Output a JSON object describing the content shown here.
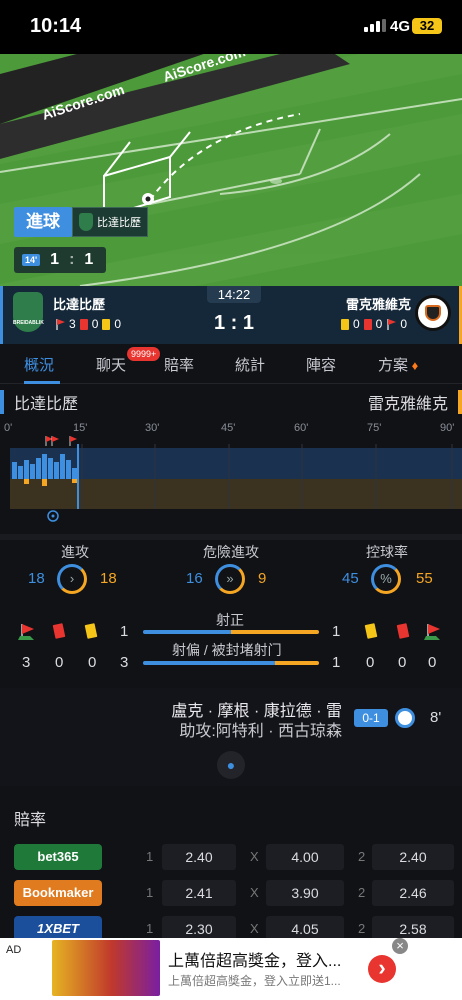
{
  "status": {
    "time": "10:14",
    "network": "4G",
    "battery": "32"
  },
  "pitch": {
    "watermark": "AiScore.com",
    "goal_label": "進球",
    "goal_team": "比達比歷",
    "minute": "14'",
    "score_home": "1",
    "score_away": "1"
  },
  "match": {
    "time": "14:22",
    "score": "1 : 1",
    "home": {
      "name": "比達比歷",
      "corners": "3",
      "red": "0",
      "yellow": "0",
      "crest_text": "BREIDABLIK"
    },
    "away": {
      "name": "雷克雅維克",
      "corners": "0",
      "red": "0",
      "yellow": "0"
    }
  },
  "tabs": [
    {
      "label": "概況"
    },
    {
      "label": "聊天"
    },
    {
      "label": "賠率"
    },
    {
      "label": "統計"
    },
    {
      "label": "陣容"
    },
    {
      "label": "方案"
    }
  ],
  "chat_badge": "9999+",
  "timeline": {
    "home": "比達比歷",
    "away": "雷克雅維克",
    "ticks": [
      "0'",
      "15'",
      "30'",
      "45'",
      "60'",
      "75'",
      "90'"
    ]
  },
  "stats": {
    "attack": {
      "label": "進攻",
      "home": "18",
      "away": "18"
    },
    "danger": {
      "label": "危險進攻",
      "home": "16",
      "away": "9"
    },
    "possession": {
      "label": "控球率",
      "home": "45",
      "away": "55",
      "symbol": "%"
    },
    "on_target": {
      "label": "射正",
      "home": "1",
      "away": "1"
    },
    "off_target": {
      "label": "射偏 / 被封堵射门",
      "home": "3",
      "away": "1"
    },
    "home_row": {
      "corners": "3",
      "red": "0",
      "yellow": "0"
    },
    "away_row": {
      "corners": "0",
      "red": "0",
      "yellow": "0"
    }
  },
  "event": {
    "scorer": "盧克 · 摩根 · 康拉德 · 雷",
    "assist": "助攻:阿特利 · 西古琼森",
    "score": "0-1",
    "minute": "8'"
  },
  "odds": {
    "title": "賠率",
    "rows": [
      {
        "bookmaker": "bet365",
        "color": "#1f7a3a",
        "c1": "1",
        "v1": "2.40",
        "cx": "X",
        "vx": "4.00",
        "c2": "2",
        "v2": "2.40"
      },
      {
        "bookmaker": "Bookmaker",
        "color": "#e07b1f",
        "c1": "1",
        "v1": "2.41",
        "cx": "X",
        "vx": "3.90",
        "c2": "2",
        "v2": "2.46"
      },
      {
        "bookmaker": "1XBET",
        "color": "#1b4f9c",
        "c1": "1",
        "v1": "2.30",
        "cx": "X",
        "vx": "4.05",
        "c2": "2",
        "v2": "2.58"
      }
    ]
  },
  "ad": {
    "label": "AD",
    "title": "上萬倍超高獎金，登入...",
    "subtitle": "上萬倍超高獎金，登入立即送1...",
    "close": "×",
    "arrow": "›"
  }
}
